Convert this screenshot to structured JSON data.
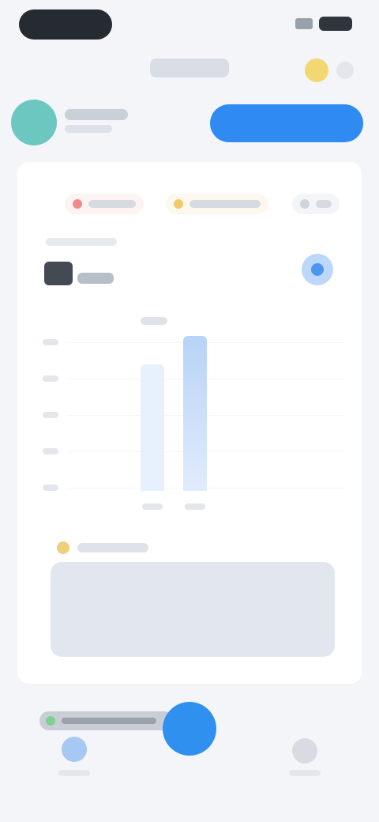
{
  "status": {
    "time": "",
    "battery": ""
  },
  "app_bar": {
    "title": ""
  },
  "profile": {
    "name": "",
    "subtitle": "",
    "action_label": ""
  },
  "filters": [
    {
      "label": "",
      "color": "#f08a8a"
    },
    {
      "label": "",
      "color": "#f2c86c"
    },
    {
      "label": "",
      "color": "#cfd5dd"
    }
  ],
  "metric": {
    "caption": "",
    "value": "",
    "unit": ""
  },
  "chart": {
    "tag": "",
    "y_labels": [
      "",
      "",
      "",
      "",
      ""
    ],
    "x_labels": [
      "",
      ""
    ]
  },
  "note": {
    "title": "",
    "body": ""
  },
  "bottom_nav": {
    "pill_label": "",
    "items": [
      {
        "label": ""
      },
      {
        "label": ""
      }
    ]
  },
  "colors": {
    "accent": "#2f8bf2",
    "avatar": "#6bc7c0",
    "background": "#f3f5f9"
  }
}
